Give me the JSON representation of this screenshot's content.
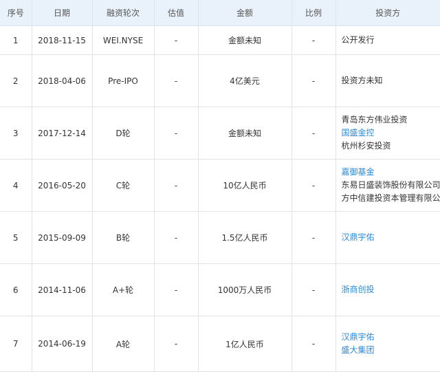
{
  "table": {
    "headers": [
      "序号",
      "日期",
      "融资轮次",
      "估值",
      "金额",
      "比例",
      "投资方"
    ],
    "rows": [
      {
        "index": "1",
        "date": "2018-11-15",
        "round": "WEI.NYSE",
        "valuation": "-",
        "amount": "金额未知",
        "ratio": "-",
        "investors": [
          {
            "name": "公开发行",
            "link": false
          }
        ]
      },
      {
        "index": "2",
        "date": "2018-04-06",
        "round": "Pre-IPO",
        "valuation": "-",
        "amount": "4亿美元",
        "ratio": "-",
        "investors": [
          {
            "name": "投资方未知",
            "link": false
          }
        ]
      },
      {
        "index": "3",
        "date": "2017-12-14",
        "round": "D轮",
        "valuation": "-",
        "amount": "金额未知",
        "ratio": "-",
        "investors": [
          {
            "name": "青岛东方伟业投资",
            "link": false
          },
          {
            "name": "国盛金控",
            "link": true
          },
          {
            "name": "杭州杉安投资",
            "link": false
          }
        ]
      },
      {
        "index": "4",
        "date": "2016-05-20",
        "round": "C轮",
        "valuation": "-",
        "amount": "10亿人民币",
        "ratio": "-",
        "investors": [
          {
            "name": "嘉御基金",
            "link": true
          },
          {
            "name": "东易日盛装饰股份有限公司",
            "link": false
          },
          {
            "name": "方中信建投资本管理有限公司",
            "link": false
          }
        ]
      },
      {
        "index": "5",
        "date": "2015-09-09",
        "round": "B轮",
        "valuation": "-",
        "amount": "1.5亿人民币",
        "ratio": "-",
        "investors": [
          {
            "name": "汉鼎宇佑",
            "link": true
          }
        ]
      },
      {
        "index": "6",
        "date": "2014-11-06",
        "round": "A+轮",
        "valuation": "-",
        "amount": "1000万人民币",
        "ratio": "-",
        "investors": [
          {
            "name": "浙商创投",
            "link": true
          }
        ]
      },
      {
        "index": "7",
        "date": "2014-06-19",
        "round": "A轮",
        "valuation": "-",
        "amount": "1亿人民币",
        "ratio": "-",
        "investors": [
          {
            "name": "汉鼎宇佑",
            "link": true
          },
          {
            "name": "盛大集团",
            "link": true
          }
        ]
      }
    ]
  },
  "colors": {
    "header_bg": "#e9f2fb",
    "link": "#2d8ad7",
    "text": "#333333",
    "grid": "#e2e2e2"
  }
}
